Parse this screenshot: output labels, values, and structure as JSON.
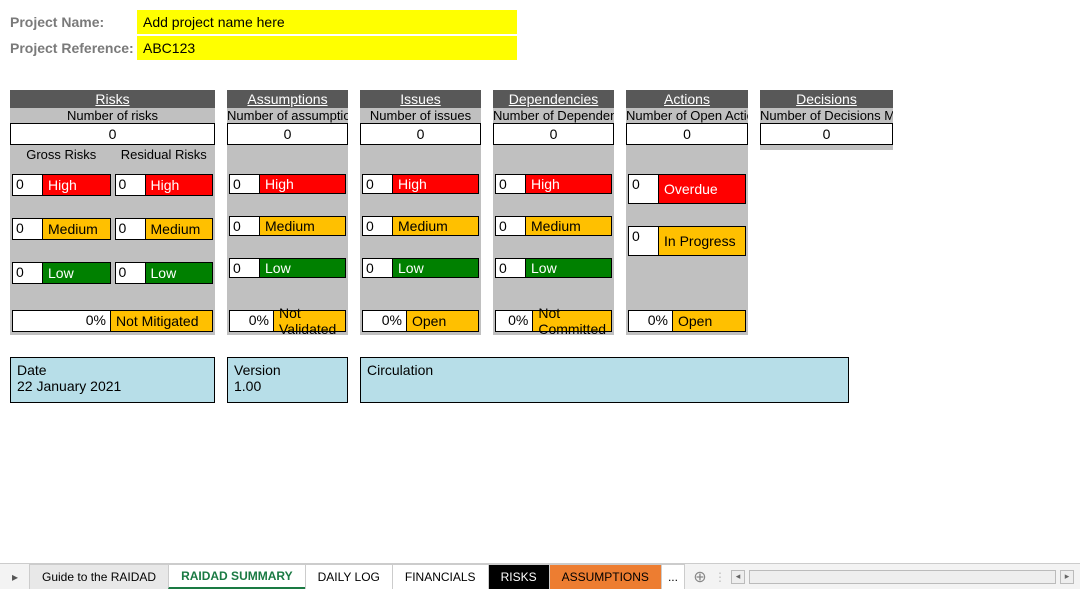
{
  "header": {
    "nameLabel": "Project Name:",
    "nameValue": "Add project name here",
    "refLabel": "Project Reference:",
    "refValue": "ABC123"
  },
  "risks": {
    "title": "Risks",
    "sub": "Number of risks",
    "count": "0",
    "grossLabel": "Gross Risks",
    "residLabel": "Residual Risks",
    "gross": {
      "highN": "0",
      "highL": "High",
      "medN": "0",
      "medL": "Medium",
      "lowN": "0",
      "lowL": "Low"
    },
    "resid": {
      "highN": "0",
      "highL": "High",
      "medN": "0",
      "medL": "Medium",
      "lowN": "0",
      "lowL": "Low"
    },
    "pct": "0%",
    "status": "Not Mitigated"
  },
  "assump": {
    "title": "Assumptions",
    "sub": "Number of assumptions",
    "count": "0",
    "highN": "0",
    "highL": "High",
    "medN": "0",
    "medL": "Medium",
    "lowN": "0",
    "lowL": "Low",
    "pct": "0%",
    "status": "Not Validated"
  },
  "issues": {
    "title": "Issues",
    "sub": "Number of issues",
    "count": "0",
    "highN": "0",
    "highL": "High",
    "medN": "0",
    "medL": "Medium",
    "lowN": "0",
    "lowL": "Low",
    "pct": "0%",
    "status": "Open"
  },
  "deps": {
    "title": "Dependencies",
    "sub": "Number of Dependencies",
    "count": "0",
    "highN": "0",
    "highL": "High",
    "medN": "0",
    "medL": "Medium",
    "lowN": "0",
    "lowL": "Low",
    "pct": "0%",
    "status": "Not Committed"
  },
  "actions": {
    "title": "Actions",
    "sub": "Number of Open Actions",
    "count": "0",
    "overN": "0",
    "overL": "Overdue",
    "progN": "0",
    "progL": "In Progress",
    "pct": "0%",
    "status": "Open"
  },
  "decisions": {
    "title": "Decisions",
    "sub": "Number of Decisions Made",
    "count": "0"
  },
  "meta": {
    "dateLabel": "Date",
    "dateValue": "22 January 2021",
    "verLabel": "Version",
    "verValue": "1.00",
    "circLabel": "Circulation"
  },
  "tabs": {
    "guide": "Guide to the RAIDAD",
    "summary": "RAIDAD SUMMARY",
    "daily": "DAILY LOG",
    "fin": "FINANCIALS",
    "risks": "RISKS",
    "assump": "ASSUMPTIONS",
    "more": "..."
  }
}
